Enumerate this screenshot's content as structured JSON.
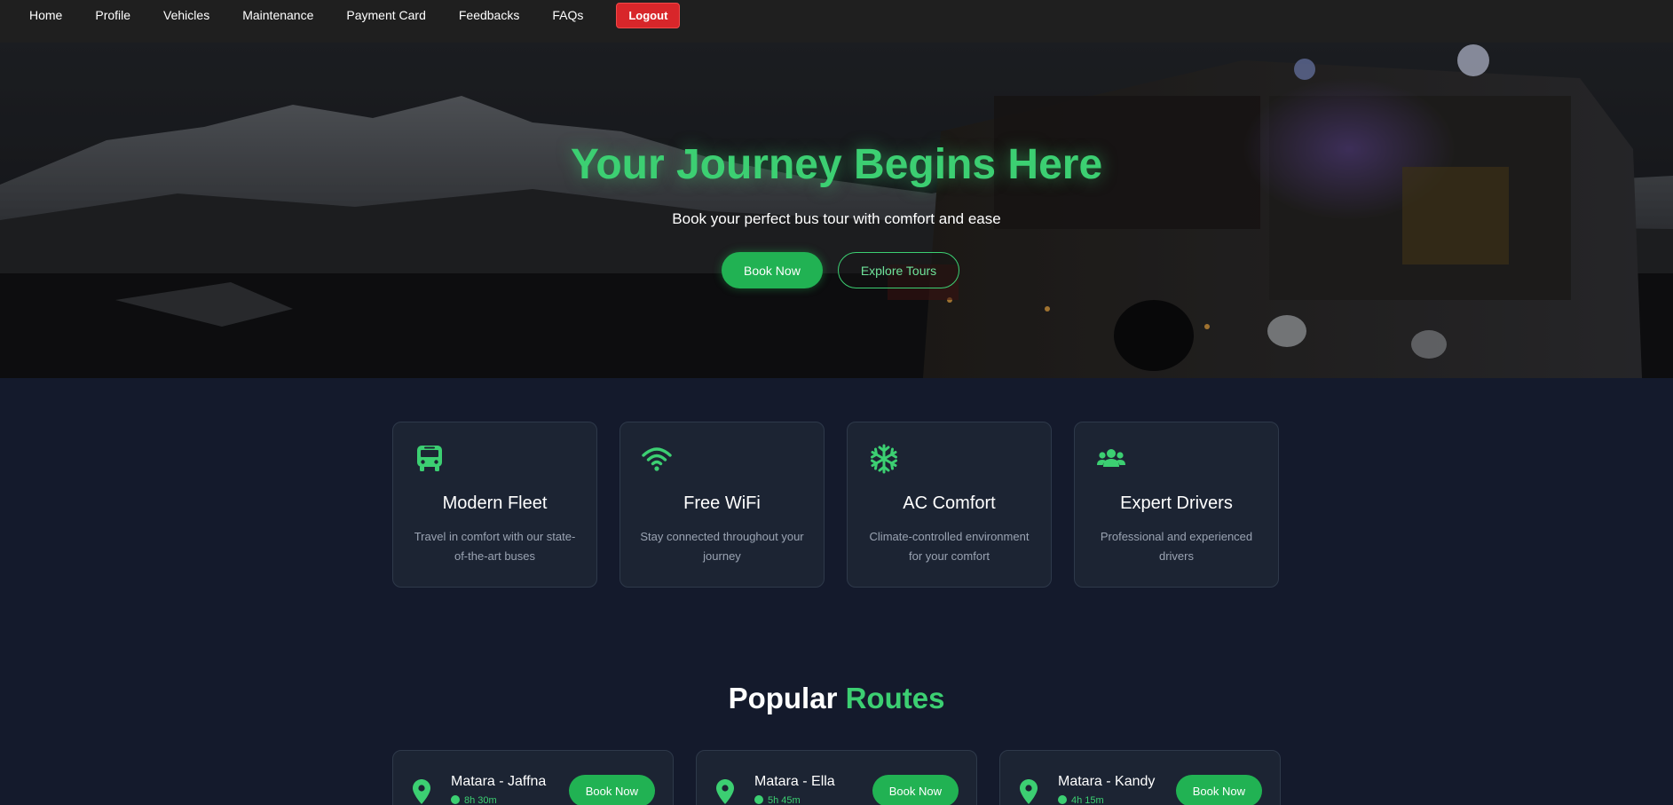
{
  "nav": {
    "items": [
      {
        "label": "Home"
      },
      {
        "label": "Profile"
      },
      {
        "label": "Vehicles"
      },
      {
        "label": "Maintenance"
      },
      {
        "label": "Payment Card"
      },
      {
        "label": "Feedbacks"
      },
      {
        "label": "FAQs"
      }
    ],
    "logout_label": "Logout"
  },
  "hero": {
    "title": "Your Journey Begins Here",
    "subtitle": "Book your perfect bus tour with comfort and ease",
    "primary_button": "Book Now",
    "secondary_button": "Explore Tours"
  },
  "features": [
    {
      "icon": "bus-icon",
      "title": "Modern Fleet",
      "description": "Travel in comfort with our state-of-the-art buses"
    },
    {
      "icon": "wifi-icon",
      "title": "Free WiFi",
      "description": "Stay connected throughout your journey"
    },
    {
      "icon": "snowflake-icon",
      "title": "AC Comfort",
      "description": "Climate-controlled environment for your comfort"
    },
    {
      "icon": "users-icon",
      "title": "Expert Drivers",
      "description": "Professional and experienced drivers"
    }
  ],
  "routes_section": {
    "title_main": "Popular",
    "title_accent": "Routes"
  },
  "routes": [
    {
      "name": "Matara - Jaffna",
      "duration": "8h 30m",
      "button": "Book Now"
    },
    {
      "name": "Matara - Ella",
      "duration": "5h 45m",
      "button": "Book Now"
    },
    {
      "name": "Matara - Kandy",
      "duration": "4h 15m",
      "button": "Book Now"
    }
  ],
  "colors": {
    "accent": "#3ccf72",
    "button_green": "#21b253",
    "logout_red": "#d8262a",
    "page_bg": "#141a2c",
    "card_bg": "#1c2433"
  }
}
